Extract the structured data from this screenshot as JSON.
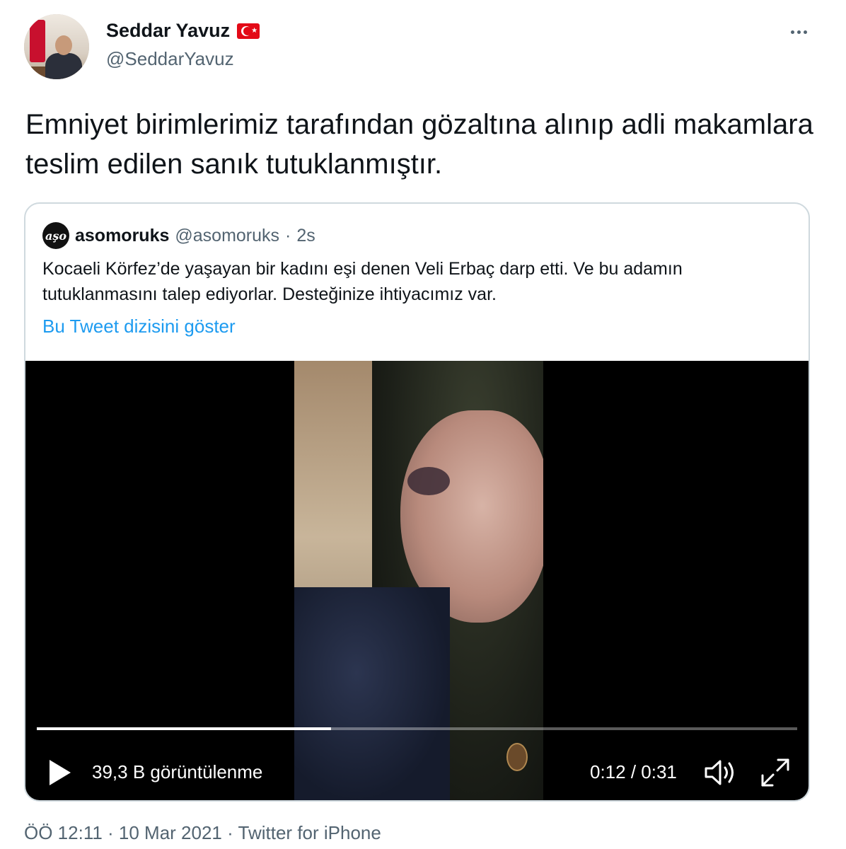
{
  "tweet": {
    "display_name": "Seddar Yavuz",
    "handle": "@SeddarYavuz",
    "text": "Emniyet birimlerimiz tarafından gözaltına alınıp adli makamlara teslim edilen sanık tutuklanmıştır.",
    "flag_emoji_name": "turkey-flag-icon",
    "more_icon": "more-horizontal-icon"
  },
  "quoted_tweet": {
    "avatar_text": "aşo",
    "display_name": "asomoruks",
    "handle": "@asomoruks",
    "separator": "·",
    "time": "2s",
    "text": "Kocaeli Körfez’de yaşayan bir kadını eşi denen Veli Erbaç darp etti. Ve bu adamın tutuklanmasını talep ediyorlar. Desteğinize ihtiyacımız var.",
    "thread_link": "Bu Tweet dizisini göster"
  },
  "video": {
    "views": "39,3 B görüntülenme",
    "timecode": "0:12 / 0:31",
    "progress": 0.387
  },
  "footer": {
    "meta": "ÖÖ 12:11 · 10 Mar 2021 · Twitter for iPhone"
  },
  "colors": {
    "link": "#1d9bf0",
    "secondary_text": "#536471",
    "border": "#cfd9de"
  }
}
